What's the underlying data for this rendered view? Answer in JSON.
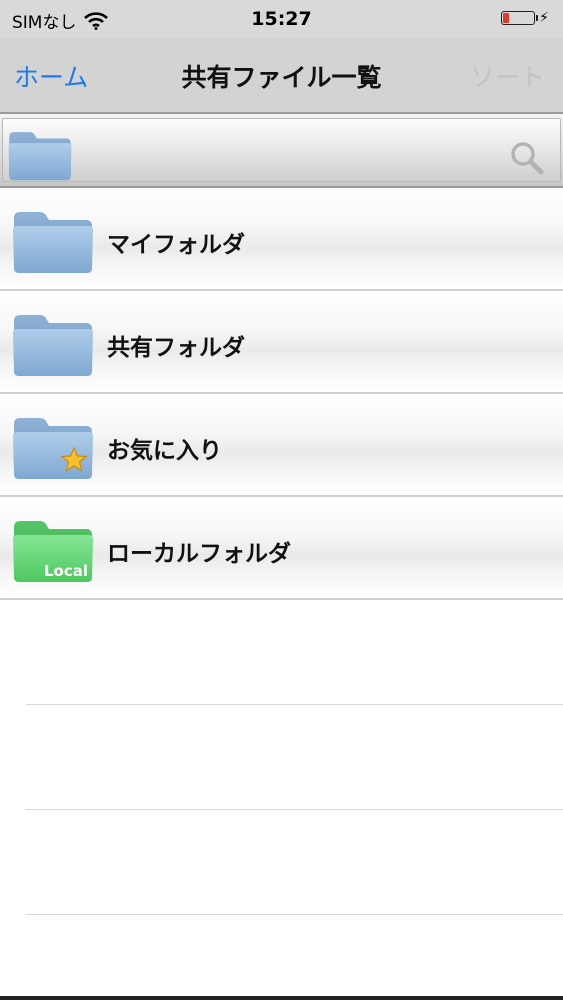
{
  "status_bar": {
    "carrier": "SIMなし",
    "time": "15:27",
    "battery_percent": 20,
    "battery_color": "#e03a2f"
  },
  "nav": {
    "back_label": "ホーム",
    "title": "共有ファイル一覧",
    "sort_label": "ソート",
    "back_color": "#1a7cf0"
  },
  "search": {
    "icon": "search-icon"
  },
  "folders": [
    {
      "label": "マイフォルダ",
      "icon": "folder-icon",
      "color": "#8db3da"
    },
    {
      "label": "共有フォルダ",
      "icon": "folder-icon",
      "color": "#8db3da"
    },
    {
      "label": "お気に入り",
      "icon": "favorite-folder-icon",
      "color": "#8db3da"
    },
    {
      "label": "ローカルフォルダ",
      "icon": "local-folder-icon",
      "color": "#5fd372",
      "badge": "Local"
    }
  ]
}
